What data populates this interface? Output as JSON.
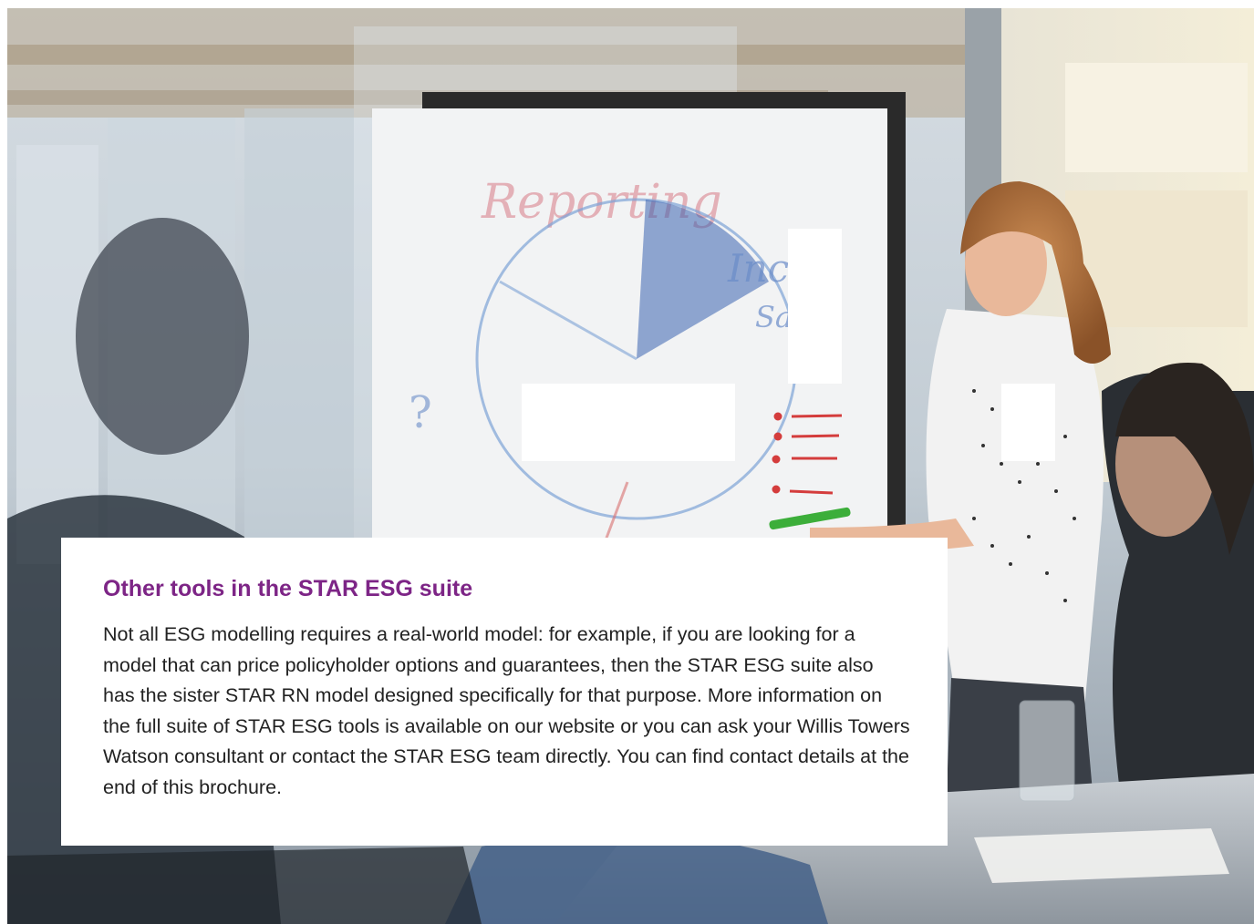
{
  "document": {
    "section_heading": "Other tools in the STAR ESG suite",
    "body_text": "Not all ESG modelling requires a real-world model: for example, if you are looking for a model that can price policyholder options and guarantees, then the STAR ESG suite also has the sister STAR RN model designed specifically for that purpose. More information on the full suite of STAR ESG tools is available on our website or you can ask your Willis Towers Watson consultant or contact the STAR ESG team directly. You can find contact details at the end of this brochure."
  },
  "photo": {
    "description_icon": "office-meeting-photo",
    "whiteboard_text": "Reporting",
    "colors": {
      "heading_accent": "#7d2586",
      "body_text": "#222222",
      "card_background": "#ffffff"
    }
  }
}
